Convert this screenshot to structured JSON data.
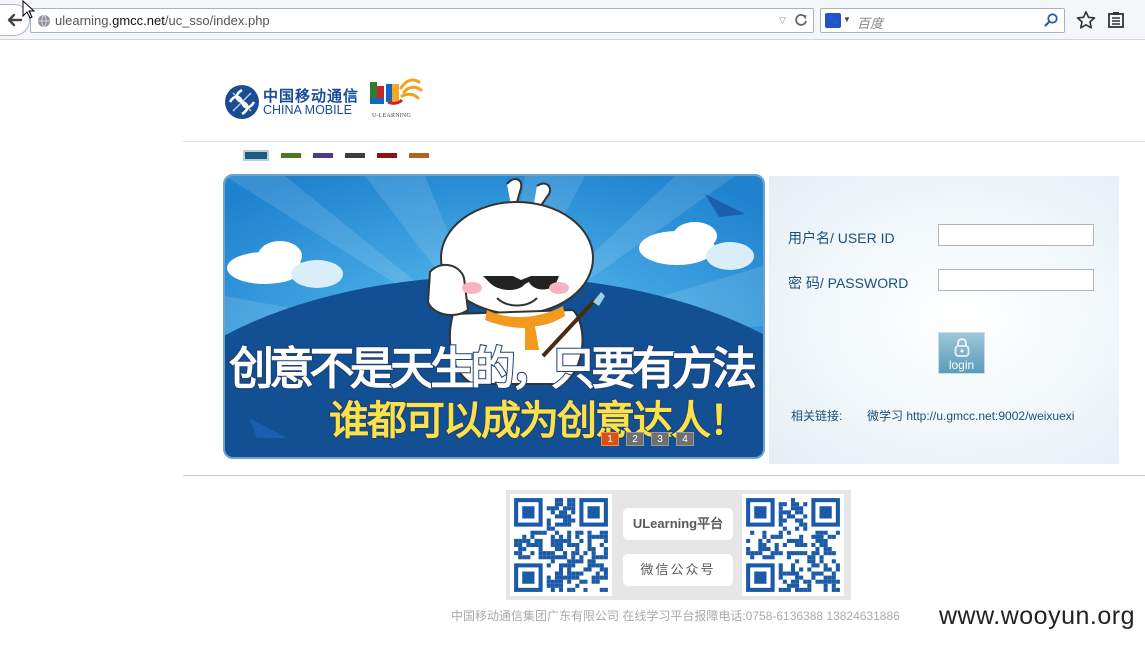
{
  "browser": {
    "url_host_prefix": "ulearning.",
    "url_domain": "gmcc.net",
    "url_path": "/uc_sso/index.php",
    "search_placeholder": "百度",
    "search_engine_icon": "baidu-paw-icon"
  },
  "header": {
    "logo_cn": "中国移动通信",
    "logo_en": "CHINA MOBILE",
    "ulearning_logo_text": "U-LEARNING"
  },
  "theme_swatches": [
    "#1d5a80",
    "#4a7a1e",
    "#4f3a85",
    "#3c3c3c",
    "#8a1414",
    "#b3641c"
  ],
  "banner": {
    "headline": "创意不是天生的，只要有方法",
    "subline": "谁都可以成为创意达人！",
    "slides": [
      "1",
      "2",
      "3",
      "4"
    ],
    "active_slide": "1"
  },
  "login": {
    "username_label": "用户名/ USER  ID",
    "password_label": "密  码/ PASSWORD",
    "username_value": "",
    "password_value": "",
    "login_button": "login",
    "related_label": "相关链接:",
    "related_link": "微学习 http://u.gmcc.net:9002/weixuexi"
  },
  "qr": {
    "left_tag": "ULearning平台",
    "right_tag": "微信公众号"
  },
  "footer": {
    "text": "中国移动通信集团广东有限公司 在线学习平台报障电话:0758-6136388 13824631886"
  },
  "watermark": "www.wooyun.org"
}
